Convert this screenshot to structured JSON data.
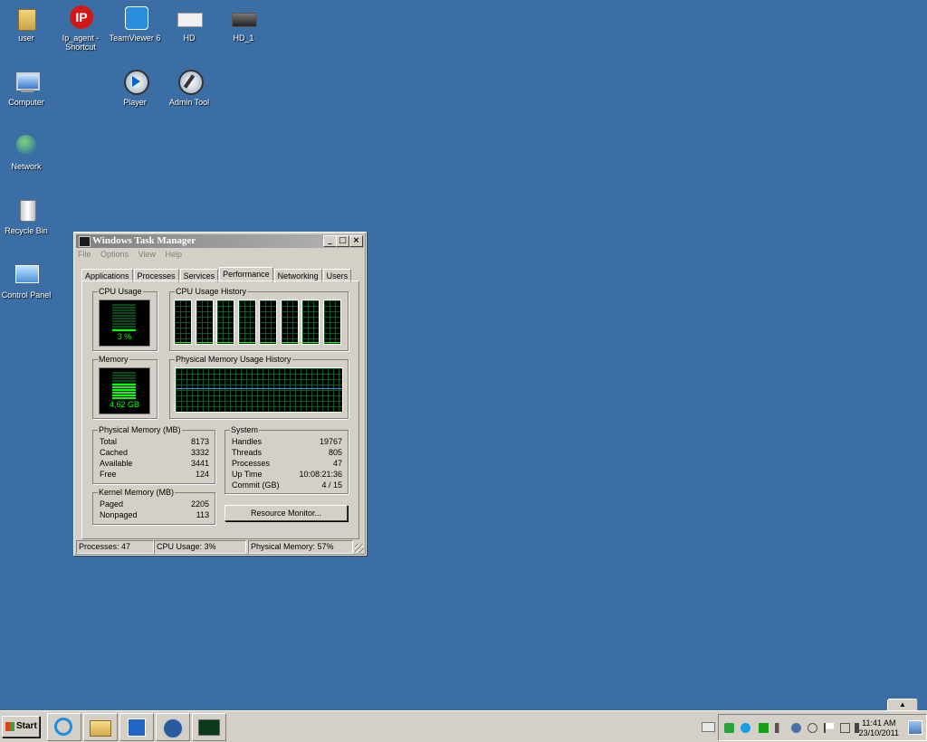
{
  "desktop": {
    "icons": [
      {
        "label": "user"
      },
      {
        "label": "Ip_agent - Shortcut"
      },
      {
        "label": "TeamViewer 6"
      },
      {
        "label": "HD"
      },
      {
        "label": "HD_1"
      },
      {
        "label": "Computer"
      },
      {
        "label": "Player"
      },
      {
        "label": "Admin Tool"
      },
      {
        "label": "Network"
      },
      {
        "label": "Recycle Bin"
      },
      {
        "label": "Control Panel"
      }
    ]
  },
  "taskmgr": {
    "title": "Windows Task Manager",
    "menu": [
      "File",
      "Options",
      "View",
      "Help"
    ],
    "tabs": [
      "Applications",
      "Processes",
      "Services",
      "Performance",
      "Networking",
      "Users"
    ],
    "active_tab": "Performance",
    "cpu_usage_label": "CPU Usage",
    "cpu_usage_value": "3 %",
    "cpu_usage_fraction": 0.03,
    "cpu_history_label": "CPU Usage History",
    "memory_label": "Memory",
    "memory_value": "4,62 GB",
    "memory_fraction": 0.57,
    "mem_history_label": "Physical Memory Usage History",
    "physical_memory": {
      "label": "Physical Memory (MB)",
      "rows": [
        {
          "k": "Total",
          "v": "8173"
        },
        {
          "k": "Cached",
          "v": "3332"
        },
        {
          "k": "Available",
          "v": "3441"
        },
        {
          "k": "Free",
          "v": "124"
        }
      ]
    },
    "kernel_memory": {
      "label": "Kernel Memory (MB)",
      "rows": [
        {
          "k": "Paged",
          "v": "2205"
        },
        {
          "k": "Nonpaged",
          "v": "113"
        }
      ]
    },
    "system": {
      "label": "System",
      "rows": [
        {
          "k": "Handles",
          "v": "19767"
        },
        {
          "k": "Threads",
          "v": "805"
        },
        {
          "k": "Processes",
          "v": "47"
        },
        {
          "k": "Up Time",
          "v": "10:08:21:36"
        },
        {
          "k": "Commit (GB)",
          "v": "4 / 15"
        }
      ]
    },
    "resource_monitor_button": "Resource Monitor...",
    "status": {
      "processes": "Processes: 47",
      "cpu": "CPU Usage: 3%",
      "memory": "Physical Memory: 57%"
    }
  },
  "taskbar": {
    "start_label": "Start",
    "pinned": [
      "internet-explorer-icon",
      "explorer-folder-icon",
      "media-player-icon",
      "teamviewer-icon",
      "task-manager-icon"
    ],
    "clock_time": "11:41 AM",
    "clock_date": "23/10/2011"
  },
  "colors": {
    "desktop": "#3b6ea5",
    "graph_green": "#00ff00",
    "grid": "#0a5a2a"
  }
}
